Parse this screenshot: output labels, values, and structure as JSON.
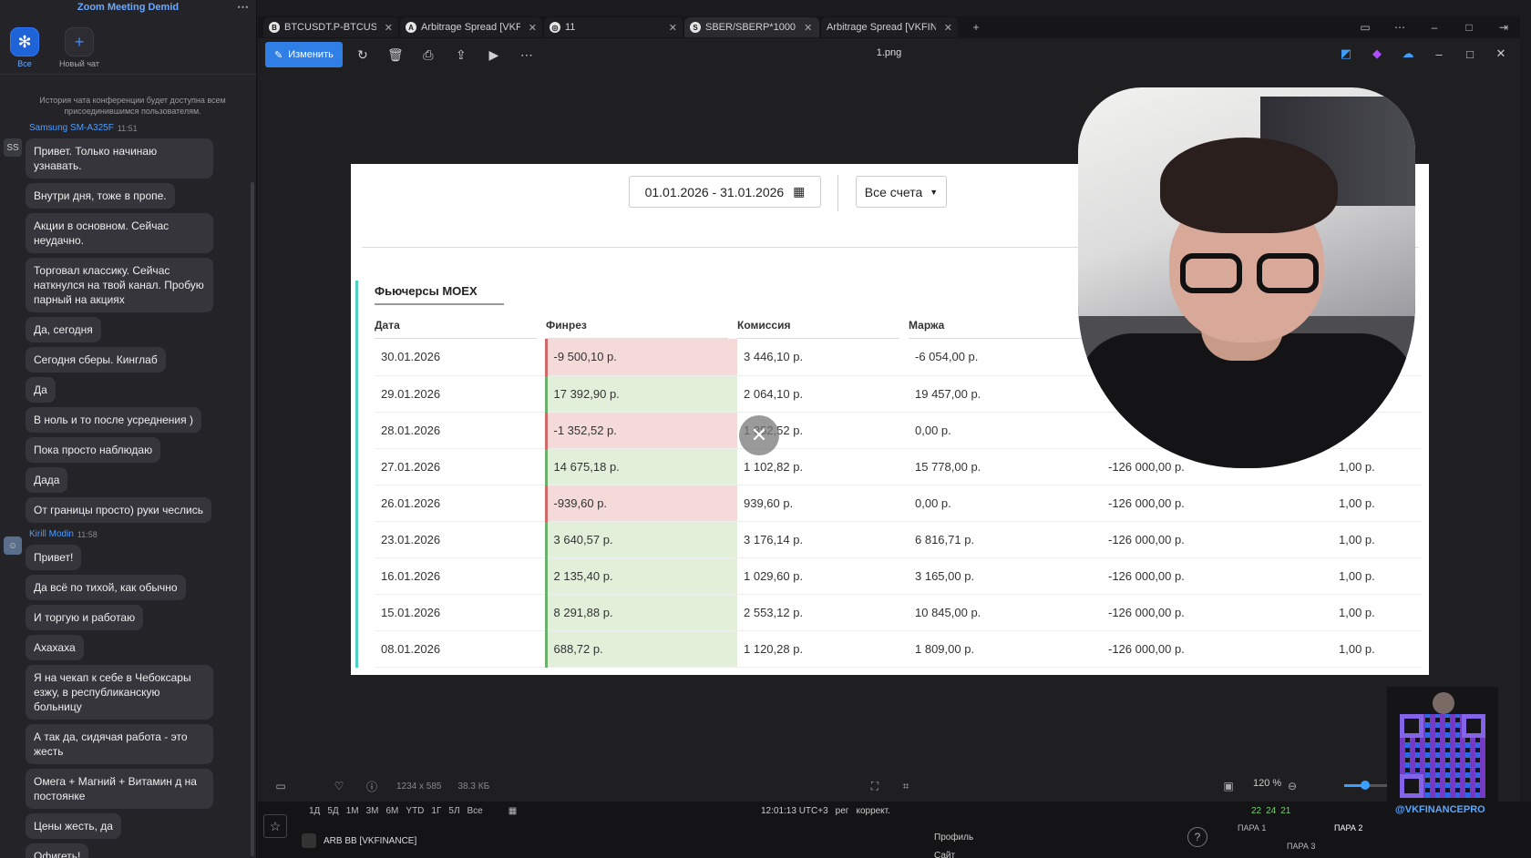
{
  "chat": {
    "title": "Zoom Meeting Demid",
    "tabs": [
      {
        "label": "Все",
        "icon": "paw-icon"
      },
      {
        "label": "Новый чат",
        "icon": "plus-icon"
      }
    ],
    "notice": "История чата конференции будет доступна всем присоединившимся пользователям.",
    "sender1": {
      "name": "Samsung SM-A325F",
      "time": "11:51",
      "avatar": "SS"
    },
    "messages1": [
      "Привет. Только начинаю узнавать.",
      "Внутри дня, тоже в пропе.",
      "Акции в основном. Сейчас неудачно.",
      "Торговал классику. Сейчас наткнулся на твой канал. Пробую парный на акциях",
      "Да, сегодня",
      "Сегодня сберы. Кинглаб",
      "Да",
      "В ноль и то после усреднения )",
      "Пока просто наблюдаю",
      "Дада",
      "От границы просто) руки чеслись"
    ],
    "sender2": {
      "name": "Kirill Modin",
      "time": "11:58"
    },
    "messages2": [
      "Привет!",
      "Да всё по тихой, как обычно",
      "И торгую и работаю",
      "Ахахаха",
      "Я на чекап к себе в Чебоксары езжу, в республиканскую больницу",
      "А так да, сидячая работа - это жесть",
      "Омега + Магний + Витамин д на постоянке",
      "Цены жесть, да",
      "Офигеть!"
    ]
  },
  "viewer": {
    "tabs": [
      {
        "label": "BTCUSDT.P-BTCUSDT.P",
        "fav": "B"
      },
      {
        "label": "Arbitrage Spread [VKF",
        "fav": "A"
      },
      {
        "label": "11",
        "fav": "◎"
      },
      {
        "label": "SBER/SBERP*1000",
        "fav": "S"
      },
      {
        "label": "Arbitrage Spread [VKFINA",
        "fav": ""
      }
    ],
    "edit_label": "Изменить",
    "file_title": "1.png",
    "image_size": "1234 x 585",
    "file_size": "38.3 КБ",
    "zoom": "120 %"
  },
  "report": {
    "date_range": "01.01.2026 - 31.01.2026",
    "accounts": "Все счета",
    "section": "Фьючерсы MOEX",
    "columns": [
      "Дата",
      "Финрез",
      "Комиссия",
      "Маржа"
    ],
    "rows": [
      {
        "date": "30.01.2026",
        "pnl": "-9 500,10 р.",
        "neg": true,
        "comm": "3 446,10 р.",
        "margin": "-6 054,00 р.",
        "c5": "",
        "c6": ""
      },
      {
        "date": "29.01.2026",
        "pnl": "17 392,90 р.",
        "neg": false,
        "comm": "2 064,10 р.",
        "margin": "19 457,00 р.",
        "c5": "",
        "c6": ""
      },
      {
        "date": "28.01.2026",
        "pnl": "-1 352,52 р.",
        "neg": true,
        "comm": "1 352,52 р.",
        "margin": "0,00 р.",
        "c5": "",
        "c6": ""
      },
      {
        "date": "27.01.2026",
        "pnl": "14 675,18 р.",
        "neg": false,
        "comm": "1 102,82 р.",
        "margin": "15 778,00 р.",
        "c5": "-126 000,00 р.",
        "c6": "1,00 р."
      },
      {
        "date": "26.01.2026",
        "pnl": "-939,60 р.",
        "neg": true,
        "comm": "939,60 р.",
        "margin": "0,00 р.",
        "c5": "-126 000,00 р.",
        "c6": "1,00 р."
      },
      {
        "date": "23.01.2026",
        "pnl": "3 640,57 р.",
        "neg": false,
        "comm": "3 176,14 р.",
        "margin": "6 816,71 р.",
        "c5": "-126 000,00 р.",
        "c6": "1,00 р."
      },
      {
        "date": "16.01.2026",
        "pnl": "2 135,40 р.",
        "neg": false,
        "comm": "1 029,60 р.",
        "margin": "3 165,00 р.",
        "c5": "-126 000,00 р.",
        "c6": "1,00 р."
      },
      {
        "date": "15.01.2026",
        "pnl": "8 291,88 р.",
        "neg": false,
        "comm": "2 553,12 р.",
        "margin": "10 845,00 р.",
        "c5": "-126 000,00 р.",
        "c6": "1,00 р."
      },
      {
        "date": "08.01.2026",
        "pnl": "688,72 р.",
        "neg": false,
        "comm": "1 120,28 р.",
        "margin": "1 809,00 р.",
        "c5": "-126 000,00 р.",
        "c6": "1,00 р."
      }
    ]
  },
  "tradingview": {
    "ranges": [
      "1Д",
      "5Д",
      "1М",
      "3М",
      "6М",
      "YTD",
      "1Г",
      "5Л",
      "Все"
    ],
    "time": "12:01:13 UTC+3",
    "session": "рег",
    "adjust": "коррект.",
    "symbol": "ARB BB [VKFINANCE]",
    "profile": "Профиль",
    "site": "Сайт",
    "pairs": [
      "ПАРА 1",
      "ПАРА 2",
      "ПАРА 3"
    ],
    "nums": [
      "22",
      "24",
      "21"
    ]
  },
  "qr": {
    "label": "@VKFINANCEPRO"
  },
  "colors": {
    "accent": "#2f7fe6",
    "gain_bg": "#e2f0da",
    "loss_bg": "#f5dada",
    "section_bar": "#4fd0c0"
  }
}
